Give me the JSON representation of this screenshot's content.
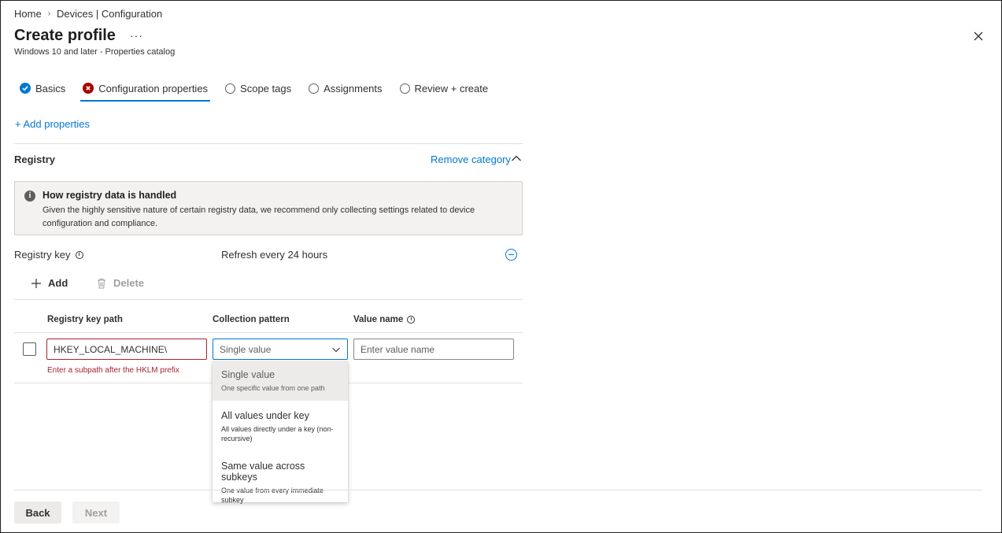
{
  "breadcrumb": {
    "home": "Home",
    "current": "Devices | Configuration"
  },
  "header": {
    "title": "Create profile",
    "more": "···",
    "subtitle": "Windows 10 and later - Properties catalog"
  },
  "tabs": [
    {
      "label": "Basics",
      "state": "complete"
    },
    {
      "label": "Configuration properties",
      "state": "error"
    },
    {
      "label": "Scope tags",
      "state": "empty"
    },
    {
      "label": "Assignments",
      "state": "empty"
    },
    {
      "label": "Review + create",
      "state": "empty"
    }
  ],
  "add_properties": "+ Add properties",
  "registry": {
    "title": "Registry",
    "remove_category": "Remove category",
    "info": {
      "title": "How registry data is handled",
      "body": "Given the highly sensitive nature of certain registry data, we recommend only collecting settings related to device configuration and compliance."
    },
    "key_label": "Registry key",
    "refresh": "Refresh every 24 hours",
    "commands": {
      "add": "Add",
      "delete": "Delete"
    },
    "columns": {
      "path": "Registry key path",
      "pattern": "Collection pattern",
      "value_name": "Value name"
    },
    "row": {
      "path_value": "HKEY_LOCAL_MACHINE\\",
      "path_error": "Enter a subpath after the HKLM prefix",
      "pattern_selected": "Single value",
      "value_name_placeholder": "Enter value name"
    },
    "dropdown_options": [
      {
        "title": "Single value",
        "desc": "One specific value from one path"
      },
      {
        "title": "All values under key",
        "desc": "All values directly under a key (non-recursive)"
      },
      {
        "title": "Same value across subkeys",
        "desc": "One value from every immediate subkey"
      }
    ]
  },
  "footer": {
    "back": "Back",
    "next": "Next"
  },
  "colors": {
    "accent": "#0078d4",
    "error": "#a4262c",
    "error_icon": "#a80000"
  }
}
